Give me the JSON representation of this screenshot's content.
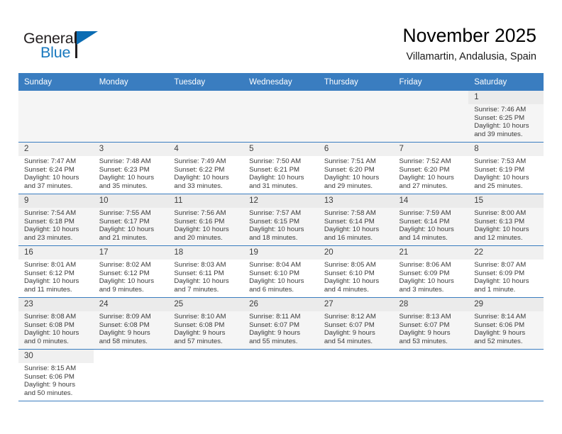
{
  "brand": {
    "name_dark": "General",
    "name_blue": "Blue",
    "accent_color": "#1878be",
    "flag_color": "#0b6cb3"
  },
  "header": {
    "title": "November 2025",
    "subtitle": "Villamartin, Andalusia, Spain"
  },
  "calendar": {
    "header_bg": "#3a7dc0",
    "weekdays": [
      "Sunday",
      "Monday",
      "Tuesday",
      "Wednesday",
      "Thursday",
      "Friday",
      "Saturday"
    ],
    "weeks": [
      [
        {
          "day": "",
          "sunrise": "",
          "sunset": "",
          "daylight1": "",
          "daylight2": "",
          "empty": true
        },
        {
          "day": "",
          "sunrise": "",
          "sunset": "",
          "daylight1": "",
          "daylight2": "",
          "empty": true
        },
        {
          "day": "",
          "sunrise": "",
          "sunset": "",
          "daylight1": "",
          "daylight2": "",
          "empty": true
        },
        {
          "day": "",
          "sunrise": "",
          "sunset": "",
          "daylight1": "",
          "daylight2": "",
          "empty": true
        },
        {
          "day": "",
          "sunrise": "",
          "sunset": "",
          "daylight1": "",
          "daylight2": "",
          "empty": true
        },
        {
          "day": "",
          "sunrise": "",
          "sunset": "",
          "daylight1": "",
          "daylight2": "",
          "empty": true
        },
        {
          "day": "1",
          "sunrise": "Sunrise: 7:46 AM",
          "sunset": "Sunset: 6:25 PM",
          "daylight1": "Daylight: 10 hours",
          "daylight2": "and 39 minutes.",
          "empty": false
        }
      ],
      [
        {
          "day": "2",
          "sunrise": "Sunrise: 7:47 AM",
          "sunset": "Sunset: 6:24 PM",
          "daylight1": "Daylight: 10 hours",
          "daylight2": "and 37 minutes.",
          "empty": false
        },
        {
          "day": "3",
          "sunrise": "Sunrise: 7:48 AM",
          "sunset": "Sunset: 6:23 PM",
          "daylight1": "Daylight: 10 hours",
          "daylight2": "and 35 minutes.",
          "empty": false
        },
        {
          "day": "4",
          "sunrise": "Sunrise: 7:49 AM",
          "sunset": "Sunset: 6:22 PM",
          "daylight1": "Daylight: 10 hours",
          "daylight2": "and 33 minutes.",
          "empty": false
        },
        {
          "day": "5",
          "sunrise": "Sunrise: 7:50 AM",
          "sunset": "Sunset: 6:21 PM",
          "daylight1": "Daylight: 10 hours",
          "daylight2": "and 31 minutes.",
          "empty": false
        },
        {
          "day": "6",
          "sunrise": "Sunrise: 7:51 AM",
          "sunset": "Sunset: 6:20 PM",
          "daylight1": "Daylight: 10 hours",
          "daylight2": "and 29 minutes.",
          "empty": false
        },
        {
          "day": "7",
          "sunrise": "Sunrise: 7:52 AM",
          "sunset": "Sunset: 6:20 PM",
          "daylight1": "Daylight: 10 hours",
          "daylight2": "and 27 minutes.",
          "empty": false
        },
        {
          "day": "8",
          "sunrise": "Sunrise: 7:53 AM",
          "sunset": "Sunset: 6:19 PM",
          "daylight1": "Daylight: 10 hours",
          "daylight2": "and 25 minutes.",
          "empty": false
        }
      ],
      [
        {
          "day": "9",
          "sunrise": "Sunrise: 7:54 AM",
          "sunset": "Sunset: 6:18 PM",
          "daylight1": "Daylight: 10 hours",
          "daylight2": "and 23 minutes.",
          "empty": false
        },
        {
          "day": "10",
          "sunrise": "Sunrise: 7:55 AM",
          "sunset": "Sunset: 6:17 PM",
          "daylight1": "Daylight: 10 hours",
          "daylight2": "and 21 minutes.",
          "empty": false
        },
        {
          "day": "11",
          "sunrise": "Sunrise: 7:56 AM",
          "sunset": "Sunset: 6:16 PM",
          "daylight1": "Daylight: 10 hours",
          "daylight2": "and 20 minutes.",
          "empty": false
        },
        {
          "day": "12",
          "sunrise": "Sunrise: 7:57 AM",
          "sunset": "Sunset: 6:15 PM",
          "daylight1": "Daylight: 10 hours",
          "daylight2": "and 18 minutes.",
          "empty": false
        },
        {
          "day": "13",
          "sunrise": "Sunrise: 7:58 AM",
          "sunset": "Sunset: 6:14 PM",
          "daylight1": "Daylight: 10 hours",
          "daylight2": "and 16 minutes.",
          "empty": false
        },
        {
          "day": "14",
          "sunrise": "Sunrise: 7:59 AM",
          "sunset": "Sunset: 6:14 PM",
          "daylight1": "Daylight: 10 hours",
          "daylight2": "and 14 minutes.",
          "empty": false
        },
        {
          "day": "15",
          "sunrise": "Sunrise: 8:00 AM",
          "sunset": "Sunset: 6:13 PM",
          "daylight1": "Daylight: 10 hours",
          "daylight2": "and 12 minutes.",
          "empty": false
        }
      ],
      [
        {
          "day": "16",
          "sunrise": "Sunrise: 8:01 AM",
          "sunset": "Sunset: 6:12 PM",
          "daylight1": "Daylight: 10 hours",
          "daylight2": "and 11 minutes.",
          "empty": false
        },
        {
          "day": "17",
          "sunrise": "Sunrise: 8:02 AM",
          "sunset": "Sunset: 6:12 PM",
          "daylight1": "Daylight: 10 hours",
          "daylight2": "and 9 minutes.",
          "empty": false
        },
        {
          "day": "18",
          "sunrise": "Sunrise: 8:03 AM",
          "sunset": "Sunset: 6:11 PM",
          "daylight1": "Daylight: 10 hours",
          "daylight2": "and 7 minutes.",
          "empty": false
        },
        {
          "day": "19",
          "sunrise": "Sunrise: 8:04 AM",
          "sunset": "Sunset: 6:10 PM",
          "daylight1": "Daylight: 10 hours",
          "daylight2": "and 6 minutes.",
          "empty": false
        },
        {
          "day": "20",
          "sunrise": "Sunrise: 8:05 AM",
          "sunset": "Sunset: 6:10 PM",
          "daylight1": "Daylight: 10 hours",
          "daylight2": "and 4 minutes.",
          "empty": false
        },
        {
          "day": "21",
          "sunrise": "Sunrise: 8:06 AM",
          "sunset": "Sunset: 6:09 PM",
          "daylight1": "Daylight: 10 hours",
          "daylight2": "and 3 minutes.",
          "empty": false
        },
        {
          "day": "22",
          "sunrise": "Sunrise: 8:07 AM",
          "sunset": "Sunset: 6:09 PM",
          "daylight1": "Daylight: 10 hours",
          "daylight2": "and 1 minute.",
          "empty": false
        }
      ],
      [
        {
          "day": "23",
          "sunrise": "Sunrise: 8:08 AM",
          "sunset": "Sunset: 6:08 PM",
          "daylight1": "Daylight: 10 hours",
          "daylight2": "and 0 minutes.",
          "empty": false
        },
        {
          "day": "24",
          "sunrise": "Sunrise: 8:09 AM",
          "sunset": "Sunset: 6:08 PM",
          "daylight1": "Daylight: 9 hours",
          "daylight2": "and 58 minutes.",
          "empty": false
        },
        {
          "day": "25",
          "sunrise": "Sunrise: 8:10 AM",
          "sunset": "Sunset: 6:08 PM",
          "daylight1": "Daylight: 9 hours",
          "daylight2": "and 57 minutes.",
          "empty": false
        },
        {
          "day": "26",
          "sunrise": "Sunrise: 8:11 AM",
          "sunset": "Sunset: 6:07 PM",
          "daylight1": "Daylight: 9 hours",
          "daylight2": "and 55 minutes.",
          "empty": false
        },
        {
          "day": "27",
          "sunrise": "Sunrise: 8:12 AM",
          "sunset": "Sunset: 6:07 PM",
          "daylight1": "Daylight: 9 hours",
          "daylight2": "and 54 minutes.",
          "empty": false
        },
        {
          "day": "28",
          "sunrise": "Sunrise: 8:13 AM",
          "sunset": "Sunset: 6:07 PM",
          "daylight1": "Daylight: 9 hours",
          "daylight2": "and 53 minutes.",
          "empty": false
        },
        {
          "day": "29",
          "sunrise": "Sunrise: 8:14 AM",
          "sunset": "Sunset: 6:06 PM",
          "daylight1": "Daylight: 9 hours",
          "daylight2": "and 52 minutes.",
          "empty": false
        }
      ],
      [
        {
          "day": "30",
          "sunrise": "Sunrise: 8:15 AM",
          "sunset": "Sunset: 6:06 PM",
          "daylight1": "Daylight: 9 hours",
          "daylight2": "and 50 minutes.",
          "empty": false
        },
        {
          "day": "",
          "sunrise": "",
          "sunset": "",
          "daylight1": "",
          "daylight2": "",
          "empty": true
        },
        {
          "day": "",
          "sunrise": "",
          "sunset": "",
          "daylight1": "",
          "daylight2": "",
          "empty": true
        },
        {
          "day": "",
          "sunrise": "",
          "sunset": "",
          "daylight1": "",
          "daylight2": "",
          "empty": true
        },
        {
          "day": "",
          "sunrise": "",
          "sunset": "",
          "daylight1": "",
          "daylight2": "",
          "empty": true
        },
        {
          "day": "",
          "sunrise": "",
          "sunset": "",
          "daylight1": "",
          "daylight2": "",
          "empty": true
        },
        {
          "day": "",
          "sunrise": "",
          "sunset": "",
          "daylight1": "",
          "daylight2": "",
          "empty": true
        }
      ]
    ]
  }
}
